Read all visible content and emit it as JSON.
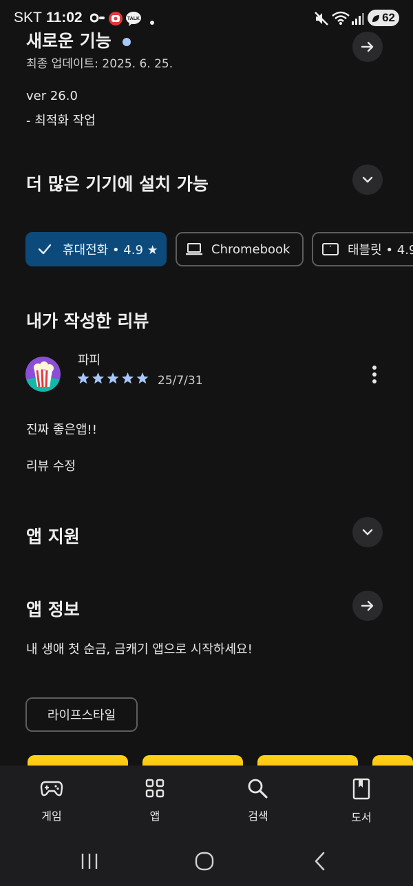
{
  "status_bar": {
    "carrier": "SKT",
    "time": "11:02",
    "talk_badge": "TALK",
    "battery": "62"
  },
  "whats_new": {
    "title": "새로운 기능",
    "updated": "최종 업데이트: 2025. 6. 25.",
    "version": "ver 26.0",
    "notes": "- 최적화 작업"
  },
  "devices": {
    "title": "더 많은 기기에 설치 가능",
    "chips": [
      {
        "label": "휴대전화 • 4.9 ★",
        "selected": true
      },
      {
        "label": "Chromebook",
        "selected": false
      },
      {
        "label": "태블릿 • 4.9",
        "selected": false
      }
    ]
  },
  "my_review": {
    "title": "내가 작성한 리뷰",
    "author": "파피",
    "rating": 5,
    "date": "25/7/31",
    "text": "진짜 좋은앱!!",
    "edit_label": "리뷰 수정"
  },
  "app_support": {
    "title": "앱 지원"
  },
  "app_info": {
    "title": "앱 정보",
    "description": "내 생애 첫 순금, 금캐기 앱으로 시작하세요!",
    "category_chip": "라이프스타일"
  },
  "bottom_nav": [
    {
      "label": "게임",
      "icon": "gamepad-icon"
    },
    {
      "label": "앱",
      "icon": "apps-grid-icon"
    },
    {
      "label": "검색",
      "icon": "search-icon"
    },
    {
      "label": "도서",
      "icon": "book-icon"
    }
  ],
  "colors": {
    "background": "#131313",
    "selected_chip": "#0c4a7c",
    "star": "#a8c7fa",
    "tile": "#ffc107"
  }
}
